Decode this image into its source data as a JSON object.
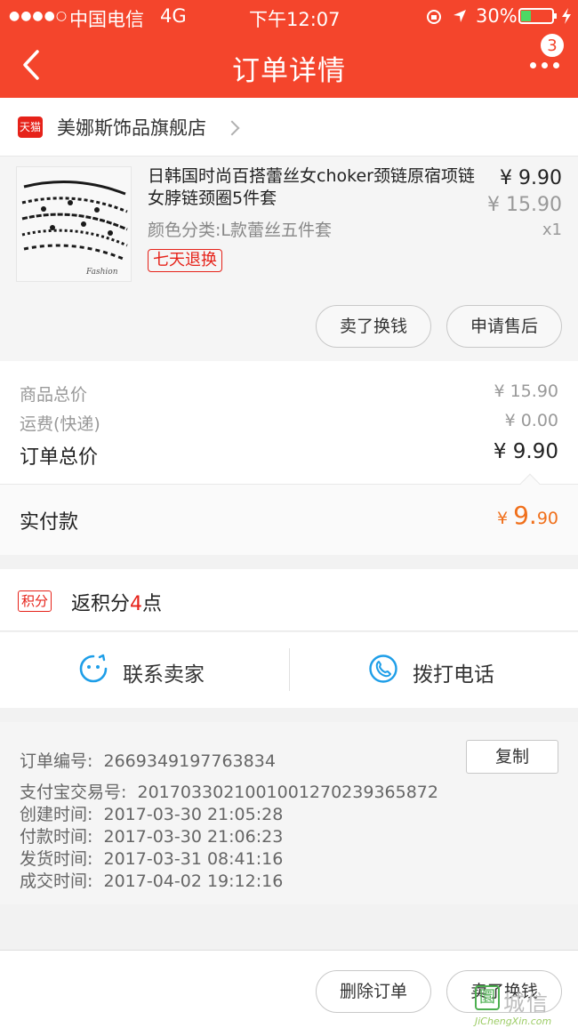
{
  "status_bar": {
    "signal": "●●●●○",
    "carrier": "中国电信",
    "network": "4G",
    "time": "下午12:07",
    "battery": "30%"
  },
  "nav": {
    "title": "订单详情",
    "badge_count": "3"
  },
  "store": {
    "logo_text": "天猫",
    "name": "美娜斯饰品旗舰店"
  },
  "product": {
    "title": "日韩国时尚百搭蕾丝女choker颈链原宿项链女脖链颈圈5件套",
    "sku": "颜色分类:L款蕾丝五件套",
    "return_tag": "七天退换",
    "price_now": "¥ 9.90",
    "price_old": "¥ 15.90",
    "qty": "x1",
    "btn_sell": "卖了换钱",
    "btn_after_sale": "申请售后"
  },
  "summary": {
    "goods_label": "商品总价",
    "goods_value": "¥ 15.90",
    "shipping_label": "运费(快递)",
    "shipping_value": "¥ 0.00",
    "total_label": "订单总价",
    "total_value": "¥ 9.90",
    "paid_label": "实付款",
    "paid_yen": "¥ ",
    "paid_int": "9.",
    "paid_dec": "90"
  },
  "points": {
    "tag": "积分",
    "prefix": "返积分",
    "num": "4",
    "suffix": "点"
  },
  "contact": {
    "seller": "联系卖家",
    "phone": "拨打电话"
  },
  "info": {
    "order_no_label": "订单编号:",
    "order_no": "2669349197763834",
    "copy": "复制",
    "alipay_label": "支付宝交易号:",
    "alipay_no": "2017033021001001270239365872",
    "created_label": "创建时间:",
    "created": "2017-03-30 21:05:28",
    "paid_label": "付款时间:",
    "paid": "2017-03-30 21:06:23",
    "shipped_label": "发货时间:",
    "shipped": "2017-03-31 08:41:16",
    "done_label": "成交时间:",
    "done": "2017-04-02 19:12:16"
  },
  "footer": {
    "delete": "删除订单",
    "sell": "卖了换钱"
  },
  "watermark": {
    "logo": "圜",
    "text": "城信",
    "url": "JiChengXin.com"
  },
  "colors": {
    "brand": "#f4452c",
    "tmall_red": "#e62219",
    "paid_orange": "#f06f1a",
    "contact_blue": "#1e9ee8"
  }
}
